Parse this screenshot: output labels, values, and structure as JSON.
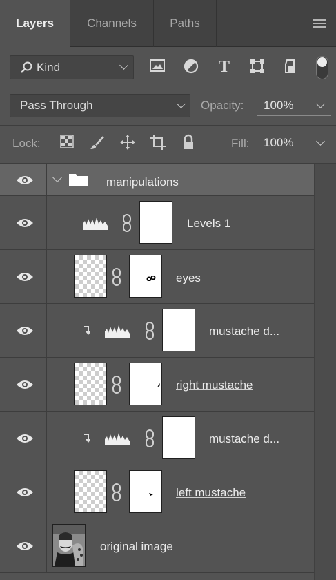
{
  "tabs": [
    {
      "label": "Layers",
      "active": true
    },
    {
      "label": "Channels",
      "active": false
    },
    {
      "label": "Paths",
      "active": false
    }
  ],
  "filter": {
    "kind_label": "Kind",
    "icons": [
      "image-filter-icon",
      "adjustment-filter-icon",
      "type-filter-icon",
      "shape-filter-icon",
      "smart-object-filter-icon"
    ],
    "type_glyph": "T"
  },
  "blend": {
    "mode": "Pass Through",
    "opacity_label": "Opacity:",
    "opacity_value": "100%"
  },
  "lock": {
    "label": "Lock:",
    "fill_label": "Fill:",
    "fill_value": "100%"
  },
  "layers": [
    {
      "name": "manipulations",
      "type": "group",
      "visible": true
    },
    {
      "name": "Levels 1",
      "type": "adjustment",
      "visible": true
    },
    {
      "name": "eyes",
      "type": "masked-pixel",
      "visible": true
    },
    {
      "name": "mustache d...",
      "type": "adjustment-clipped",
      "visible": true
    },
    {
      "name": "right mustache",
      "type": "masked-pixel",
      "visible": true
    },
    {
      "name": "mustache d...",
      "type": "adjustment-clipped",
      "visible": true
    },
    {
      "name": "left mustache",
      "type": "masked-pixel",
      "visible": true
    },
    {
      "name": "original image",
      "type": "pixel",
      "visible": true
    }
  ],
  "colors": {
    "panel_bg": "#535353",
    "tab_bg": "#424242",
    "group_row_bg": "#656565"
  }
}
